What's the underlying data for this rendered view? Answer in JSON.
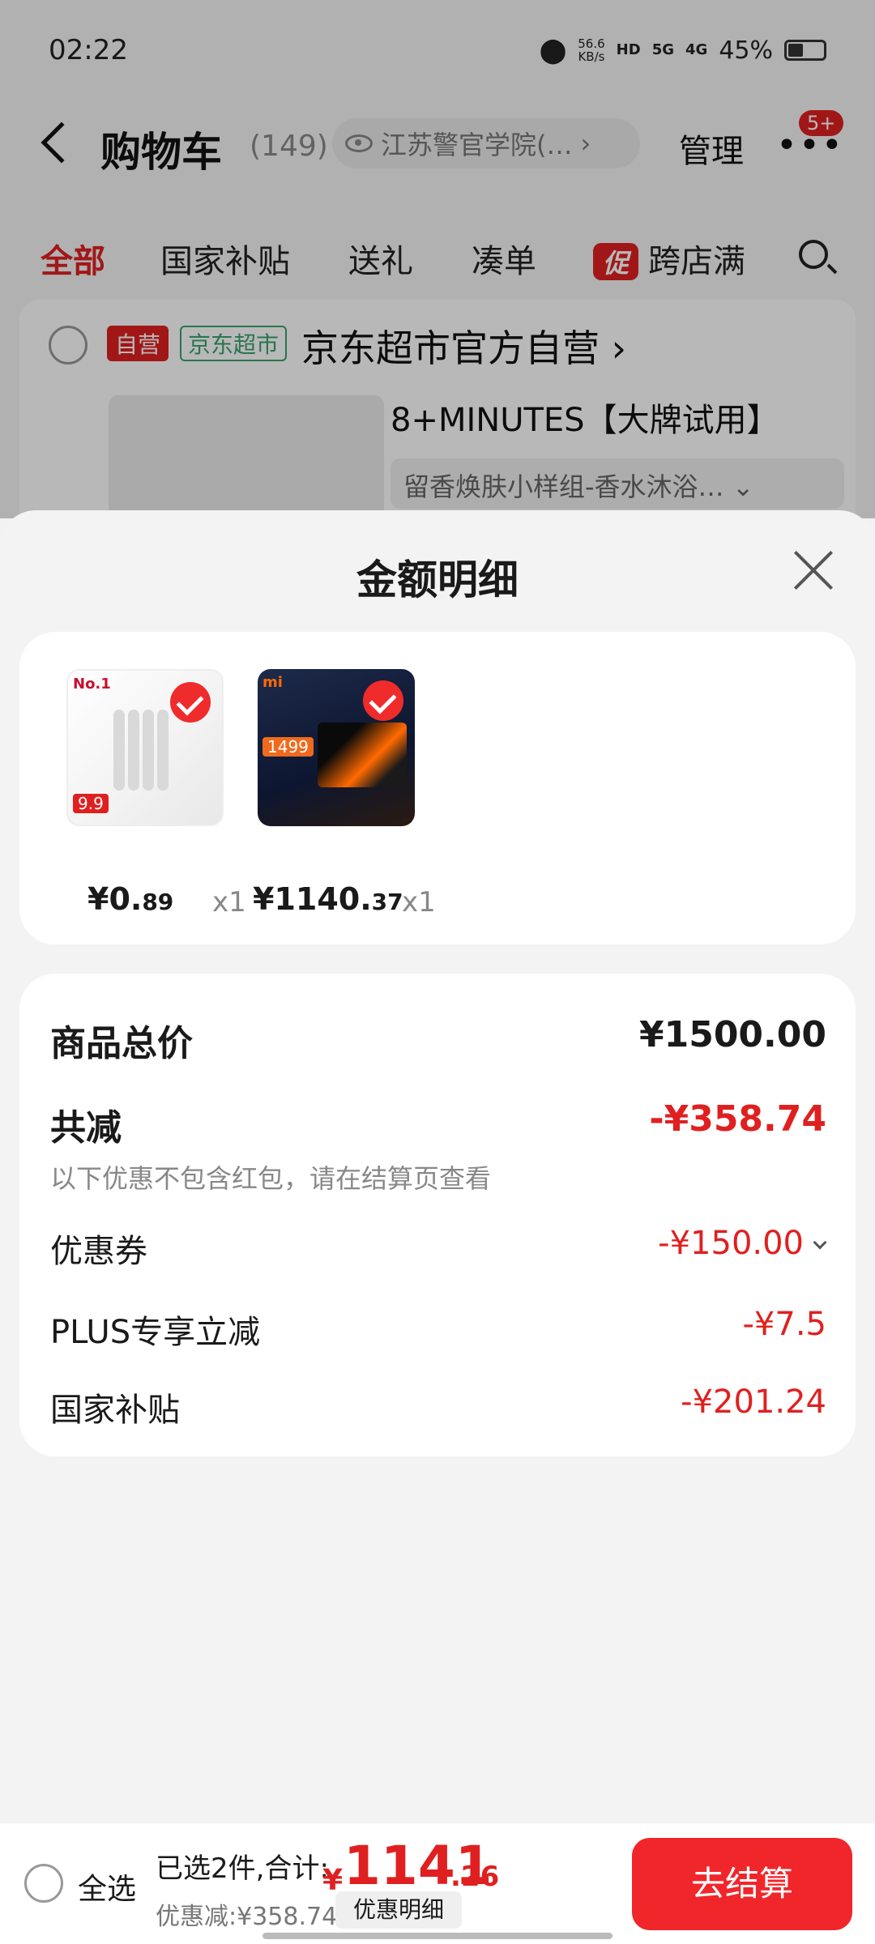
{
  "status_bar": {
    "time": "02:22",
    "net_speed_value": "56.6",
    "net_speed_unit": "KB/s",
    "hd": "HD",
    "sig1": "5G",
    "sig2": "4G",
    "battery": "45%"
  },
  "header": {
    "title": "购物车",
    "count": "(149)",
    "location": "江苏警官学院(…",
    "manage_label": "管理",
    "more_label": "•••",
    "badge": "5+"
  },
  "tabs": [
    {
      "label": "全部"
    },
    {
      "label": "国家补贴"
    },
    {
      "label": "送礼"
    },
    {
      "label": "凑单"
    },
    {
      "label": "跨店满"
    }
  ],
  "promo_mark": "促",
  "store": {
    "self_tag": "自营",
    "mart_tag": "京东超市",
    "name": "京东超市官方自营 ›",
    "product_title": "8+MINUTES【大牌试用】",
    "product_spec": "留香焕肤小样组-香水沐浴…  ⌄"
  },
  "sheet": {
    "title": "金额明细",
    "items": [
      {
        "thumb_tag": "No.1",
        "thumb_price": "9.9",
        "price_int": "¥0.",
        "price_dec": "89",
        "qty": "x1"
      },
      {
        "thumb_tag": "mi",
        "thumb_price": "1499",
        "price_int": "¥1140.",
        "price_dec": "37",
        "qty": "x1"
      }
    ],
    "detail": {
      "total_label": "商品总价",
      "total_value": "¥1500.00",
      "reduce_label": "共减",
      "reduce_value": "-¥358.74",
      "reduce_note": "以下优惠不包含红包，请在结算页查看",
      "coupon_label": "优惠券",
      "coupon_value": "-¥150.00",
      "plus_label": "PLUS专享立减",
      "plus_value": "-¥7.5",
      "subsidy_label": "国家补贴",
      "subsidy_value": "-¥201.24"
    }
  },
  "bottom_bar": {
    "select_all": "全选",
    "summary": "已选2件,合计:",
    "currency": "¥",
    "total_int": "1141",
    "total_dec": ".26",
    "discount": "优惠减:¥358.74",
    "detail_button": "优惠明细",
    "checkout_button": "去结算"
  },
  "colors": {
    "accent_red": "#e02020",
    "checkout_red": "#f0262b"
  }
}
